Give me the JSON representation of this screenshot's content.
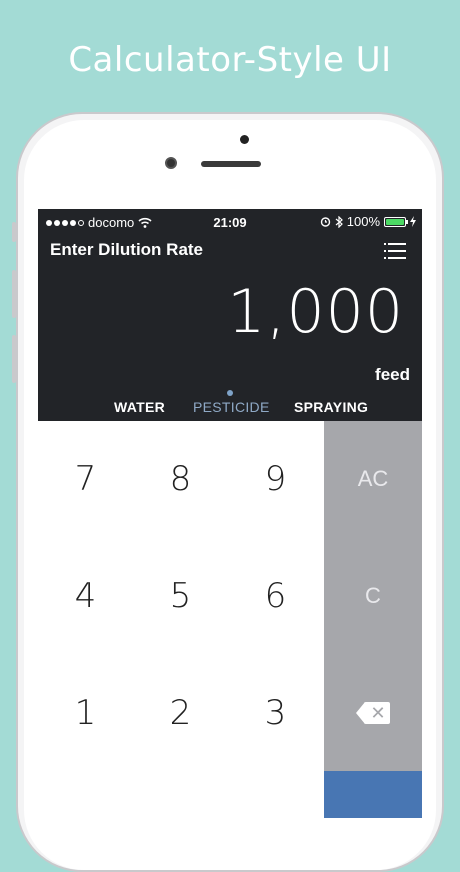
{
  "headline": "Calculator-Style UI",
  "status_bar": {
    "carrier": "docomo",
    "time": "21:09",
    "battery": "100%"
  },
  "header": {
    "title": "Enter Dilution Rate"
  },
  "display": {
    "value": "1,000",
    "unit": "feed"
  },
  "tabs": [
    {
      "label": "WATER",
      "active": false
    },
    {
      "label": "PESTICIDE",
      "active": true
    },
    {
      "label": "SPRAYING",
      "active": false
    }
  ],
  "keypad": {
    "digits": [
      "7",
      "8",
      "9",
      "4",
      "5",
      "6",
      "1",
      "2",
      "3"
    ],
    "clear_all": "AC",
    "clear": "C"
  },
  "colors": {
    "background": "#a3dbd5",
    "screen": "#222428",
    "active_tab": "#8fa9c6",
    "side_keys": "#a6a7ab",
    "action_key": "#4876b3"
  }
}
